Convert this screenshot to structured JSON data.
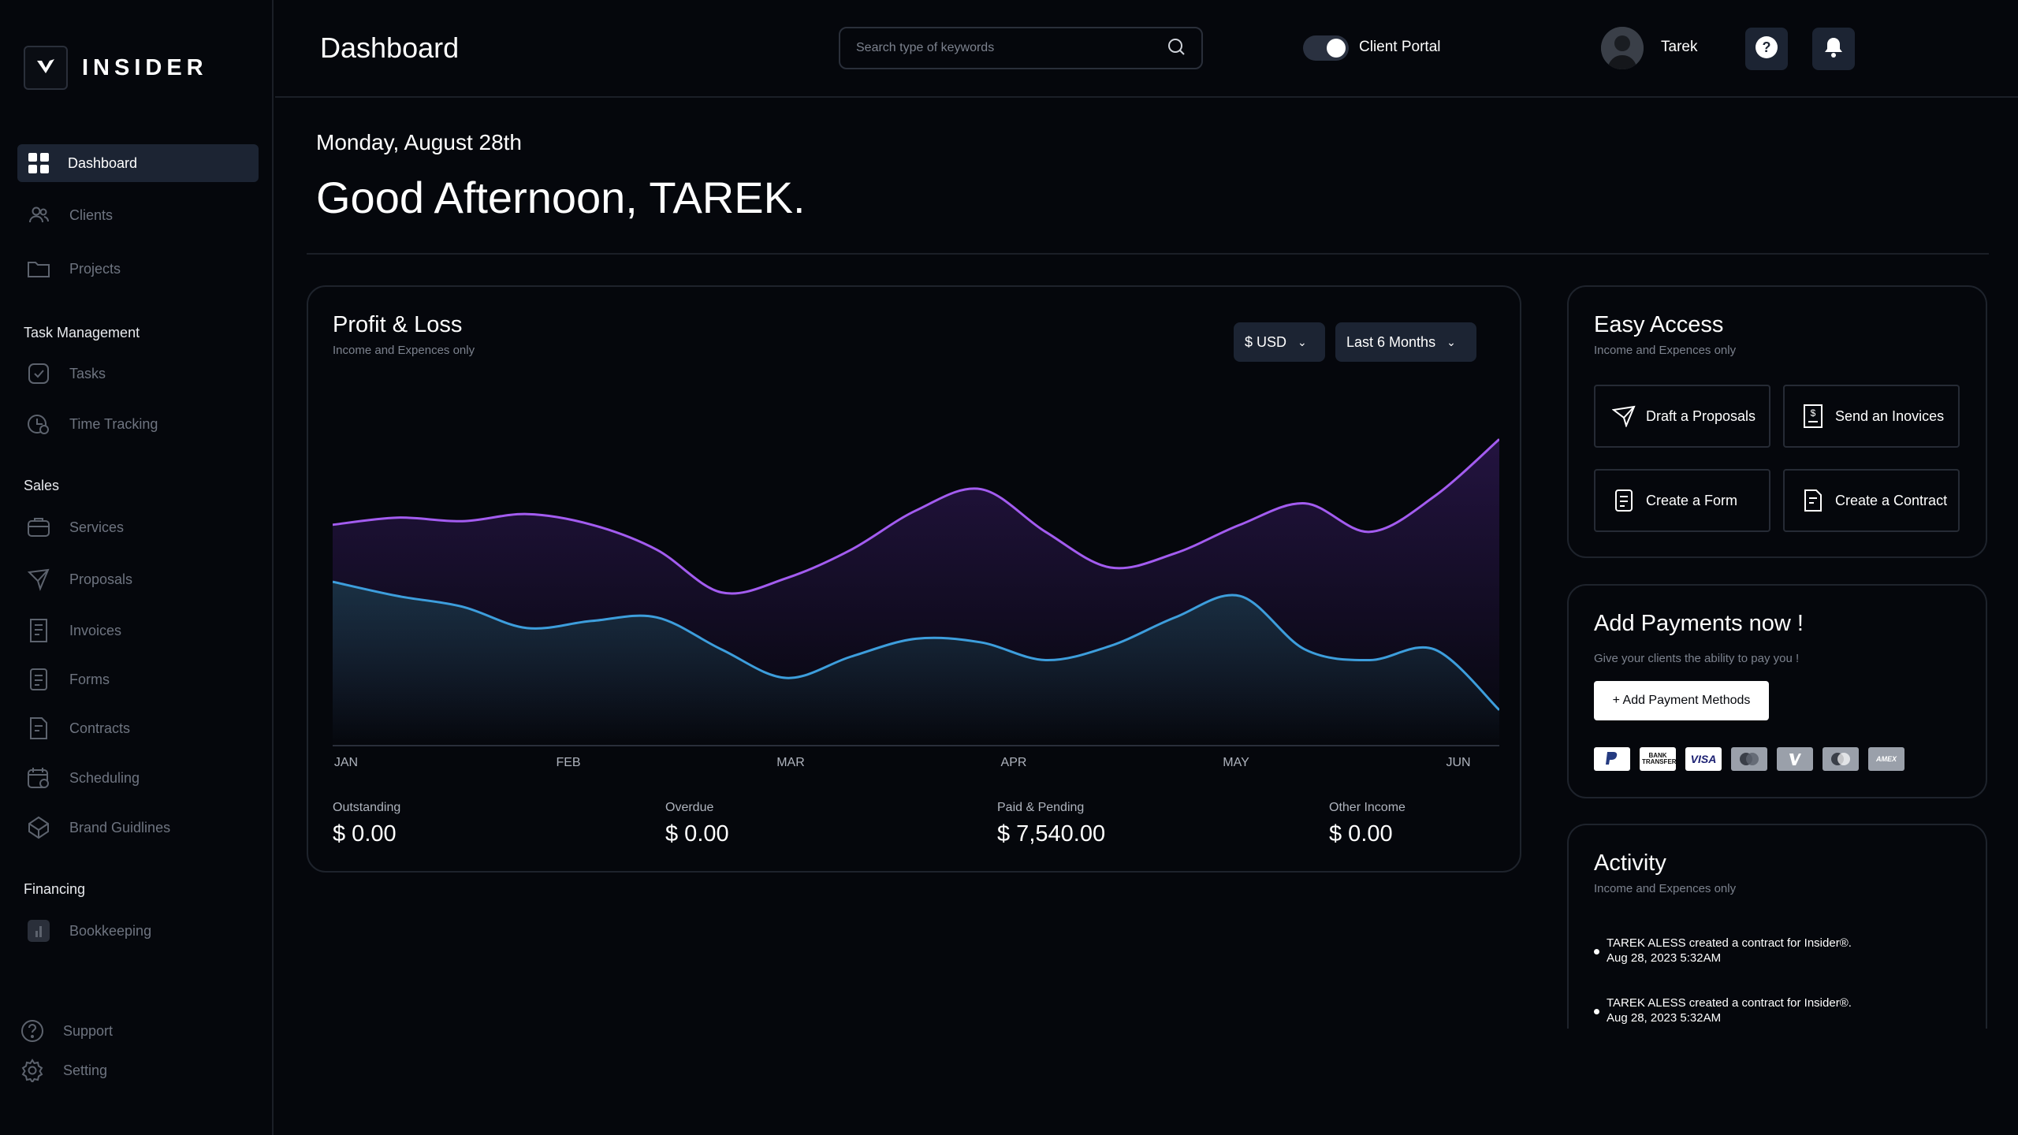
{
  "sidebar": {
    "brand": "INSIDER",
    "items": [
      {
        "label": "Dashboard"
      },
      {
        "label": "Clients"
      },
      {
        "label": "Projects"
      }
    ],
    "sections": {
      "task_management": "Task Management",
      "sales": "Sales",
      "financing": "Financing"
    },
    "task_items": [
      {
        "label": "Tasks"
      },
      {
        "label": "Time Tracking"
      }
    ],
    "sales_items": [
      {
        "label": "Services"
      },
      {
        "label": "Proposals"
      },
      {
        "label": "Invoices"
      },
      {
        "label": "Forms"
      },
      {
        "label": "Contracts"
      },
      {
        "label": "Scheduling"
      },
      {
        "label": "Brand Guidlines"
      }
    ],
    "financing_items": [
      {
        "label": "Bookkeeping"
      }
    ],
    "bottom_items": [
      {
        "label": "Support"
      },
      {
        "label": "Setting"
      }
    ]
  },
  "header": {
    "title": "Dashboard",
    "search_placeholder": "Search type of keywords",
    "portal_label": "Client Portal",
    "user_name": "Tarek"
  },
  "greeting": {
    "date": "Monday, August 28th",
    "message": "Good Afternoon, TAREK."
  },
  "profit_loss": {
    "title": "Profit & Loss",
    "subtitle": "Income and Expences only",
    "currency": "$ USD",
    "range": "Last 6 Months",
    "stats": [
      {
        "label": "Outstanding",
        "value": "$ 0.00"
      },
      {
        "label": "Overdue",
        "value": "$ 0.00"
      },
      {
        "label": "Paid & Pending",
        "value": "$ 7,540.00"
      },
      {
        "label": "Other Income",
        "value": "$ 0.00"
      }
    ]
  },
  "chart_data": {
    "type": "line",
    "categories": [
      "JAN",
      "FEB",
      "MAR",
      "APR",
      "MAY",
      "JUN"
    ],
    "series": [
      {
        "color": "#a35cf0",
        "values": [
          62,
          64,
          63,
          65,
          62,
          55,
          43,
          47,
          55,
          66,
          72,
          60,
          50,
          54,
          62,
          68,
          60,
          70,
          86
        ]
      },
      {
        "color": "#3d9edc",
        "values": [
          46,
          42,
          39,
          33,
          35,
          36,
          27,
          19,
          25,
          30,
          29,
          24,
          28,
          36,
          42,
          27,
          24,
          27,
          10
        ]
      }
    ],
    "grid": false
  },
  "easy_access": {
    "title": "Easy Access",
    "subtitle": "Income and Expences only",
    "actions": [
      {
        "label": "Draft a Proposals"
      },
      {
        "label": "Send an Inovices"
      },
      {
        "label": "Create a Form"
      },
      {
        "label": "Create  a Contract"
      }
    ]
  },
  "payments": {
    "title": "Add Payments now !",
    "subtitle": "Give your clients the ability to pay you !",
    "button": "+ Add Payment Methods",
    "methods": [
      "PayPal",
      "BANK TRANSFER",
      "VISA",
      "Mastercard",
      "Venmo",
      "Maestro",
      "AMEX"
    ]
  },
  "activity": {
    "title": "Activity",
    "subtitle": "Income and Expences only",
    "items": [
      {
        "text": "TAREK ALESS created a contract for Insider®.",
        "time": "Aug 28, 2023 5:32AM"
      },
      {
        "text": "TAREK ALESS created a contract for Insider®.",
        "time": "Aug 28, 2023 5:32AM"
      }
    ]
  }
}
